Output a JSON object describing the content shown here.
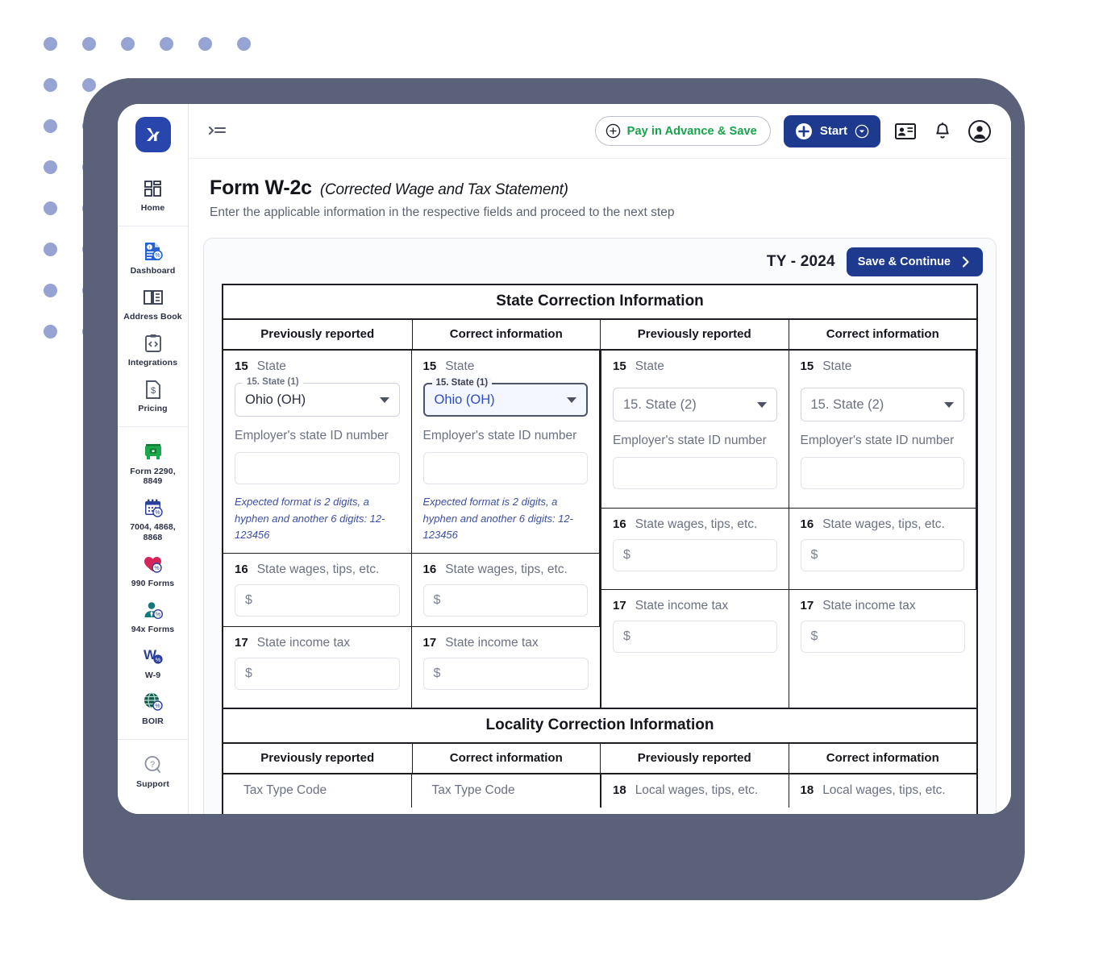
{
  "app": {
    "logo_text": "X",
    "collapse_icon": "collapse-menu-icon"
  },
  "sidebar": {
    "groups": [
      {
        "items": [
          {
            "label": "Home",
            "icon": "grid-dashboard-icon"
          }
        ]
      },
      {
        "items": [
          {
            "label": "Dashboard",
            "icon": "document-report-icon"
          },
          {
            "label": "Address Book",
            "icon": "open-book-icon"
          },
          {
            "label": "Integrations",
            "icon": "code-clipboard-icon"
          },
          {
            "label": "Pricing",
            "icon": "dollar-document-icon"
          }
        ]
      },
      {
        "items": [
          {
            "label": "Form 2290, 8849",
            "icon": "truck-icon"
          },
          {
            "label": "7004, 4868, 8868",
            "icon": "calendar-icon"
          },
          {
            "label": "990 Forms",
            "icon": "heart-icon"
          },
          {
            "label": "94x Forms",
            "icon": "person-tie-icon"
          },
          {
            "label": "W-9",
            "icon": "w-letter-icon"
          },
          {
            "label": "BOIR",
            "icon": "globe-icon"
          }
        ]
      },
      {
        "items": [
          {
            "label": "Support",
            "icon": "question-balloon-icon"
          }
        ]
      }
    ]
  },
  "topbar": {
    "pay_in_advance": "Pay in Advance & Save",
    "start_button": "Start",
    "icons": [
      "contact-card-icon",
      "bell-icon",
      "account-circle-icon"
    ]
  },
  "page": {
    "title": "Form W-2c",
    "subtitle": "(Corrected Wage and Tax Statement)",
    "description": "Enter the applicable information in the respective fields and proceed to the next step"
  },
  "panel": {
    "tax_year": "TY - 2024",
    "save_continue": "Save & Continue"
  },
  "colors": {
    "brand_blue": "#1e3a8f",
    "green_accent": "#16a34a",
    "frame_gray": "#5a6178",
    "dot_blue": "#97a3d2",
    "hint_blue": "#3b4fa5"
  },
  "state_section": {
    "title": "State Correction Information",
    "column_headers": [
      "Previously reported",
      "Correct information",
      "Previously reported",
      "Correct information"
    ],
    "groups": [
      {
        "state_label_num": "15",
        "state_label": "State",
        "state_legend": "15. State (1)",
        "state_value": "Ohio (OH)",
        "state_focused": false,
        "employer_id_label": "Employer's state ID number",
        "employer_id_value": "",
        "hint": "Expected format is 2 digits, a hyphen and another 6 digits: 12-123456",
        "wages_num": "16",
        "wages_label": "State wages, tips, etc.",
        "wages_value": "$",
        "tax_num": "17",
        "tax_label": "State income tax",
        "tax_value": "$"
      },
      {
        "state_label_num": "15",
        "state_label": "State",
        "state_legend": "15. State (1)",
        "state_value": "Ohio (OH)",
        "state_focused": true,
        "employer_id_label": "Employer's state ID number",
        "employer_id_value": "",
        "hint": "Expected format is 2 digits, a hyphen and another 6 digits: 12-123456",
        "wages_num": "16",
        "wages_label": "State wages, tips, etc.",
        "wages_value": "$",
        "tax_num": "17",
        "tax_label": "State income tax",
        "tax_value": "$"
      },
      {
        "state_label_num": "15",
        "state_label": "State",
        "state_legend": "",
        "state_value": "15. State (2)",
        "state_focused": false,
        "employer_id_label": "Employer's state ID number",
        "employer_id_value": "",
        "hint": "",
        "wages_num": "16",
        "wages_label": "State wages, tips, etc.",
        "wages_value": "$",
        "tax_num": "17",
        "tax_label": "State income tax",
        "tax_value": "$"
      },
      {
        "state_label_num": "15",
        "state_label": "State",
        "state_legend": "",
        "state_value": "15. State (2)",
        "state_focused": false,
        "employer_id_label": "Employer's state ID number",
        "employer_id_value": "",
        "hint": "",
        "wages_num": "16",
        "wages_label": "State wages, tips, etc.",
        "wages_value": "$",
        "tax_num": "17",
        "tax_label": "State income tax",
        "tax_value": "$"
      }
    ]
  },
  "locality_section": {
    "title": "Locality Correction Information",
    "column_headers": [
      "Previously reported",
      "Correct information",
      "Previously reported",
      "Correct information"
    ],
    "row": [
      {
        "num": "",
        "label": "Tax Type Code"
      },
      {
        "num": "",
        "label": "Tax Type Code"
      },
      {
        "num": "18",
        "label": "Local wages, tips, etc."
      },
      {
        "num": "18",
        "label": "Local wages, tips, etc."
      }
    ]
  }
}
